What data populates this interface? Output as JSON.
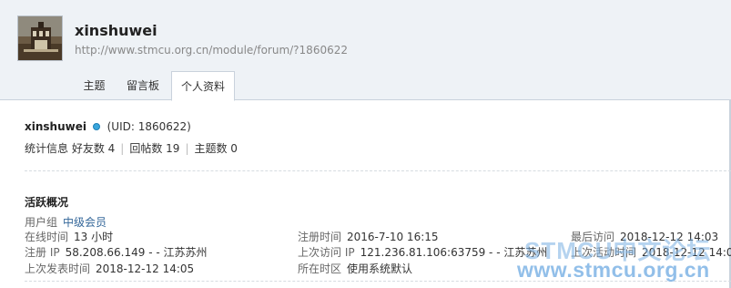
{
  "header": {
    "username": "xinshuwei",
    "url": "http://www.stmcu.org.cn/module/forum/?1860622"
  },
  "tabs": [
    {
      "label": "主题"
    },
    {
      "label": "留言板"
    },
    {
      "label": "个人资料"
    }
  ],
  "profile": {
    "username": "xinshuwei",
    "uid": "(UID: 1860622)",
    "stats_label": "统计信息",
    "friends": "好友数 4",
    "replies": "回帖数 19",
    "topics": "主题数 0"
  },
  "activity": {
    "title": "活跃概况",
    "user_group_label": "用户组",
    "user_group_value": "中级会员",
    "online_time_label": "在线时间",
    "online_time_value": "13 小时",
    "register_time_label": "注册时间",
    "register_time_value": "2016-7-10 16:15",
    "last_visit_label": "最后访问",
    "last_visit_value": "2018-12-12 14:03",
    "register_ip_label": "注册 IP",
    "register_ip_value": "58.208.66.149 - - 江苏苏州",
    "last_visit_ip_label": "上次访问 IP",
    "last_visit_ip_value": "121.236.81.106:63759 - - 江苏苏州",
    "last_active_label": "上次活动时间",
    "last_active_value": "2018-12-12 14:0",
    "last_post_label": "上次发表时间",
    "last_post_value": "2018-12-12 14:05",
    "timezone_label": "所在时区",
    "timezone_value": "使用系统默认"
  },
  "watermark": {
    "line1": "STMCU中文论坛",
    "line2": "www.stmcu.org.cn"
  }
}
